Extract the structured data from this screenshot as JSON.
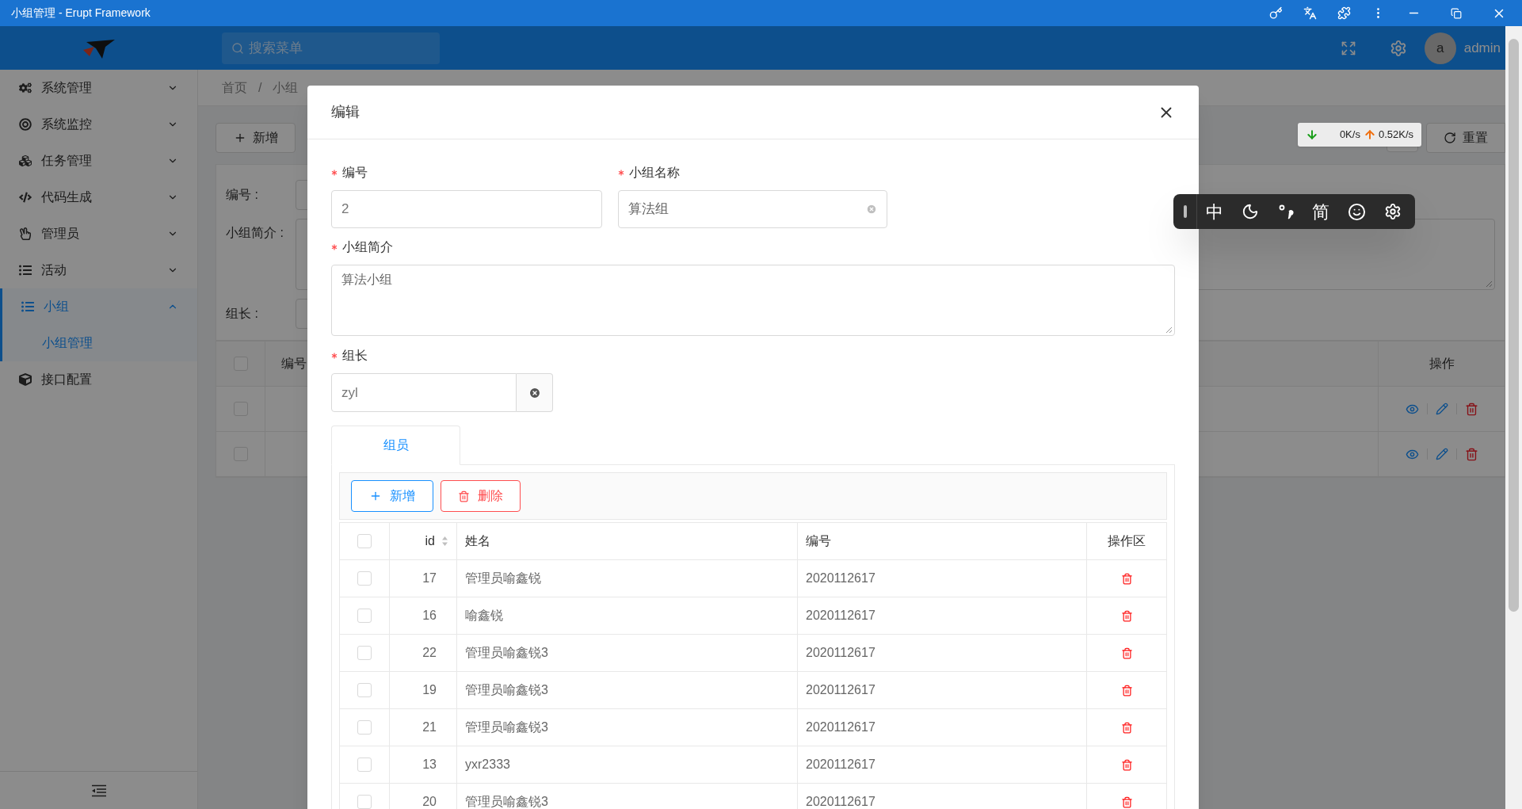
{
  "window": {
    "title": "小组管理 - Erupt Framework"
  },
  "header": {
    "search": {
      "placeholder": "搜索菜单"
    },
    "avatar": "a",
    "user": "admin"
  },
  "sidebar": {
    "items": [
      {
        "label": "系统管理",
        "kind": "submenu",
        "expanded": false,
        "selected": false
      },
      {
        "label": "系统监控",
        "kind": "submenu",
        "expanded": false,
        "selected": false
      },
      {
        "label": "任务管理",
        "kind": "submenu",
        "expanded": false,
        "selected": false
      },
      {
        "label": "代码生成",
        "kind": "submenu",
        "expanded": false,
        "selected": false
      },
      {
        "label": "管理员",
        "kind": "submenu",
        "expanded": false,
        "selected": false
      },
      {
        "label": "活动",
        "kind": "submenu",
        "expanded": false,
        "selected": false
      },
      {
        "label": "小组",
        "kind": "submenu",
        "expanded": true,
        "selected": true,
        "children": [
          {
            "label": "小组管理",
            "selected": true
          }
        ]
      },
      {
        "label": "接口配置",
        "kind": "link",
        "selected": false
      }
    ]
  },
  "breadcrumb": {
    "items": [
      "首页",
      "小组"
    ],
    "separator": "/"
  },
  "page": {
    "toolbar": {
      "add": "新增",
      "reset": "重置"
    },
    "search_form": {
      "labels": [
        "编号 :",
        "小组简介 :",
        "组长 :"
      ]
    },
    "table": {
      "select_all": {
        "checked": false
      },
      "columns": [
        "编号",
        "操作"
      ],
      "rows": [
        {
          "checked": false
        },
        {
          "checked": false
        }
      ]
    }
  },
  "net_speed": {
    "down": "0K/s",
    "up": "0.52K/s"
  },
  "ime_toolbar": {
    "mode": "中",
    "script": "简"
  },
  "modal": {
    "title": "编辑",
    "fields": [
      {
        "label": "编号",
        "required": true,
        "kind": "text",
        "value": "2"
      },
      {
        "label": "小组名称",
        "required": true,
        "kind": "clearable",
        "value": "算法组"
      },
      {
        "label": "小组简介",
        "required": true,
        "kind": "textarea",
        "value": "算法小组"
      },
      {
        "label": "组长",
        "required": true,
        "kind": "reference",
        "value": "zyl"
      }
    ],
    "tabs": [
      {
        "label": "组员",
        "selected": true
      }
    ],
    "members": {
      "add": "新增",
      "delete": "删除",
      "select_all": {
        "checked": false
      },
      "columns": [
        {
          "label": "id",
          "sortable": true
        },
        {
          "label": "姓名",
          "sortable": false
        },
        {
          "label": "编号",
          "sortable": false
        },
        {
          "label": "操作区",
          "sortable": false
        }
      ],
      "rows": [
        {
          "checked": false,
          "id": "17",
          "name": "管理员喻鑫锐",
          "number": "2020112617"
        },
        {
          "checked": false,
          "id": "16",
          "name": "喻鑫锐",
          "number": "2020112617"
        },
        {
          "checked": false,
          "id": "22",
          "name": "管理员喻鑫锐3",
          "number": "2020112617"
        },
        {
          "checked": false,
          "id": "19",
          "name": "管理员喻鑫锐3",
          "number": "2020112617"
        },
        {
          "checked": false,
          "id": "21",
          "name": "管理员喻鑫锐3",
          "number": "2020112617"
        },
        {
          "checked": false,
          "id": "13",
          "name": "yxr2333",
          "number": "2020112617"
        },
        {
          "checked": false,
          "id": "20",
          "name": "管理员喻鑫锐3",
          "number": "2020112617"
        }
      ]
    }
  }
}
